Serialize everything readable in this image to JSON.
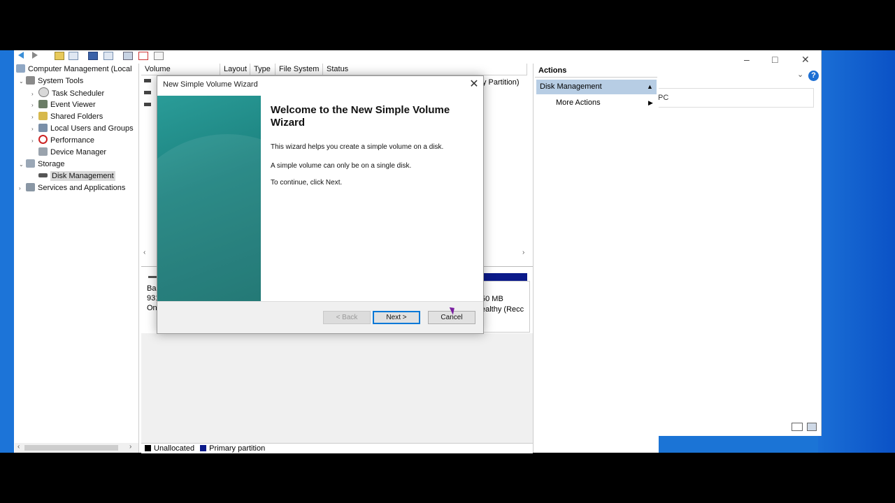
{
  "tree": {
    "items": [
      {
        "label": "Computer Management (Local",
        "indent": 0,
        "expander": ""
      },
      {
        "label": "System Tools",
        "indent": 1,
        "expander": "⌄"
      },
      {
        "label": "Task Scheduler",
        "indent": 2,
        "expander": "›"
      },
      {
        "label": "Event Viewer",
        "indent": 2,
        "expander": "›"
      },
      {
        "label": "Shared Folders",
        "indent": 2,
        "expander": "›"
      },
      {
        "label": "Local Users and Groups",
        "indent": 2,
        "expander": "›"
      },
      {
        "label": "Performance",
        "indent": 2,
        "expander": "›"
      },
      {
        "label": "Device Manager",
        "indent": 2,
        "expander": ""
      },
      {
        "label": "Storage",
        "indent": 1,
        "expander": "⌄"
      },
      {
        "label": "Disk Management",
        "indent": 2,
        "expander": ""
      },
      {
        "label": "Services and Applications",
        "indent": 1,
        "expander": "›"
      }
    ]
  },
  "volume_list": {
    "columns": [
      "Volume",
      "Layout",
      "Type",
      "File System",
      "Status"
    ],
    "partial_status_text": "y Partition)"
  },
  "disk_view": {
    "left_fragments": [
      "Bas",
      "931",
      "On"
    ],
    "right_fragments": [
      "50 MB",
      "ealthy (Recc"
    ]
  },
  "legend": {
    "unallocated": "Unallocated",
    "primary": "Primary partition"
  },
  "actions": {
    "header": "Actions",
    "section": "Disk Management",
    "more_actions": "More Actions"
  },
  "wizard": {
    "title": "New Simple Volume Wizard",
    "heading": "Welcome to the New Simple Volume Wizard",
    "paragraph1": "This wizard helps you create a simple volume on a disk.",
    "paragraph2": "A simple volume can only be on a single disk.",
    "paragraph3": "To continue, click Next.",
    "back_label": "< Back",
    "next_label": "Next >",
    "cancel_label": "Cancel"
  },
  "explorer": {
    "address_fragment": "PC"
  },
  "colors": {
    "desktop": "#1b74d6",
    "banner": "#1b807d",
    "selection": "#b7cde4",
    "primary_partition": "#0b1a8a"
  }
}
